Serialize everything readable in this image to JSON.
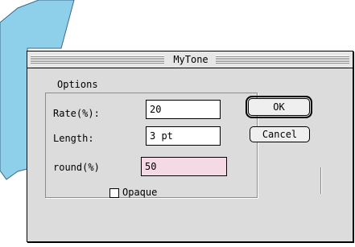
{
  "window": {
    "title": "MyTone"
  },
  "options": {
    "group_label": "Options",
    "rate_label": "Rate(%):",
    "rate_value": "20",
    "length_label": "Length:",
    "length_value": "3 pt",
    "round_label": "round(%)",
    "round_value": "50",
    "opaque_label": "Opaque",
    "opaque_checked": false
  },
  "buttons": {
    "ok_label": "OK",
    "cancel_label": "Cancel"
  },
  "colors": {
    "background_shape": "#8ecfe9",
    "round_field": "#f5d9e5"
  }
}
